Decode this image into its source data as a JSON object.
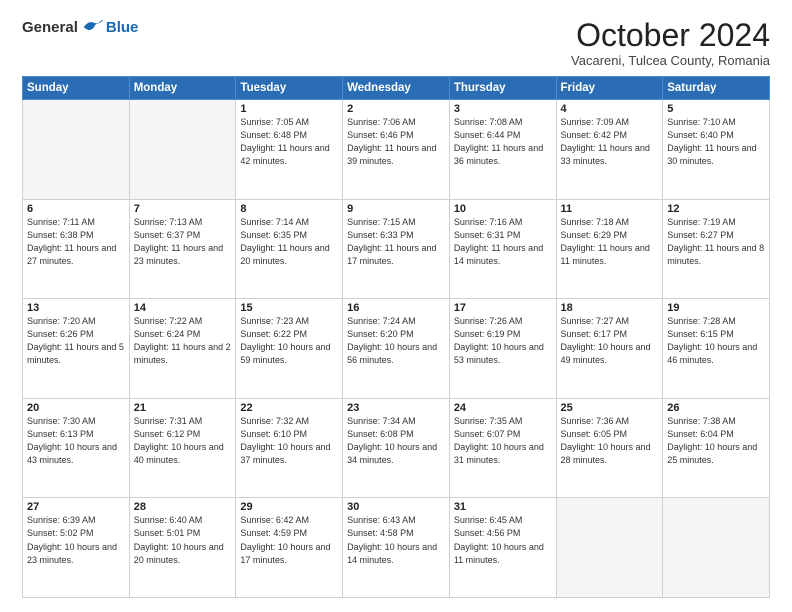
{
  "logo": {
    "general": "General",
    "blue": "Blue"
  },
  "header": {
    "month": "October 2024",
    "subtitle": "Vacareni, Tulcea County, Romania"
  },
  "weekdays": [
    "Sunday",
    "Monday",
    "Tuesday",
    "Wednesday",
    "Thursday",
    "Friday",
    "Saturday"
  ],
  "weeks": [
    [
      {
        "day": "",
        "info": ""
      },
      {
        "day": "",
        "info": ""
      },
      {
        "day": "1",
        "info": "Sunrise: 7:05 AM\nSunset: 6:48 PM\nDaylight: 11 hours and 42 minutes."
      },
      {
        "day": "2",
        "info": "Sunrise: 7:06 AM\nSunset: 6:46 PM\nDaylight: 11 hours and 39 minutes."
      },
      {
        "day": "3",
        "info": "Sunrise: 7:08 AM\nSunset: 6:44 PM\nDaylight: 11 hours and 36 minutes."
      },
      {
        "day": "4",
        "info": "Sunrise: 7:09 AM\nSunset: 6:42 PM\nDaylight: 11 hours and 33 minutes."
      },
      {
        "day": "5",
        "info": "Sunrise: 7:10 AM\nSunset: 6:40 PM\nDaylight: 11 hours and 30 minutes."
      }
    ],
    [
      {
        "day": "6",
        "info": "Sunrise: 7:11 AM\nSunset: 6:38 PM\nDaylight: 11 hours and 27 minutes."
      },
      {
        "day": "7",
        "info": "Sunrise: 7:13 AM\nSunset: 6:37 PM\nDaylight: 11 hours and 23 minutes."
      },
      {
        "day": "8",
        "info": "Sunrise: 7:14 AM\nSunset: 6:35 PM\nDaylight: 11 hours and 20 minutes."
      },
      {
        "day": "9",
        "info": "Sunrise: 7:15 AM\nSunset: 6:33 PM\nDaylight: 11 hours and 17 minutes."
      },
      {
        "day": "10",
        "info": "Sunrise: 7:16 AM\nSunset: 6:31 PM\nDaylight: 11 hours and 14 minutes."
      },
      {
        "day": "11",
        "info": "Sunrise: 7:18 AM\nSunset: 6:29 PM\nDaylight: 11 hours and 11 minutes."
      },
      {
        "day": "12",
        "info": "Sunrise: 7:19 AM\nSunset: 6:27 PM\nDaylight: 11 hours and 8 minutes."
      }
    ],
    [
      {
        "day": "13",
        "info": "Sunrise: 7:20 AM\nSunset: 6:26 PM\nDaylight: 11 hours and 5 minutes."
      },
      {
        "day": "14",
        "info": "Sunrise: 7:22 AM\nSunset: 6:24 PM\nDaylight: 11 hours and 2 minutes."
      },
      {
        "day": "15",
        "info": "Sunrise: 7:23 AM\nSunset: 6:22 PM\nDaylight: 10 hours and 59 minutes."
      },
      {
        "day": "16",
        "info": "Sunrise: 7:24 AM\nSunset: 6:20 PM\nDaylight: 10 hours and 56 minutes."
      },
      {
        "day": "17",
        "info": "Sunrise: 7:26 AM\nSunset: 6:19 PM\nDaylight: 10 hours and 53 minutes."
      },
      {
        "day": "18",
        "info": "Sunrise: 7:27 AM\nSunset: 6:17 PM\nDaylight: 10 hours and 49 minutes."
      },
      {
        "day": "19",
        "info": "Sunrise: 7:28 AM\nSunset: 6:15 PM\nDaylight: 10 hours and 46 minutes."
      }
    ],
    [
      {
        "day": "20",
        "info": "Sunrise: 7:30 AM\nSunset: 6:13 PM\nDaylight: 10 hours and 43 minutes."
      },
      {
        "day": "21",
        "info": "Sunrise: 7:31 AM\nSunset: 6:12 PM\nDaylight: 10 hours and 40 minutes."
      },
      {
        "day": "22",
        "info": "Sunrise: 7:32 AM\nSunset: 6:10 PM\nDaylight: 10 hours and 37 minutes."
      },
      {
        "day": "23",
        "info": "Sunrise: 7:34 AM\nSunset: 6:08 PM\nDaylight: 10 hours and 34 minutes."
      },
      {
        "day": "24",
        "info": "Sunrise: 7:35 AM\nSunset: 6:07 PM\nDaylight: 10 hours and 31 minutes."
      },
      {
        "day": "25",
        "info": "Sunrise: 7:36 AM\nSunset: 6:05 PM\nDaylight: 10 hours and 28 minutes."
      },
      {
        "day": "26",
        "info": "Sunrise: 7:38 AM\nSunset: 6:04 PM\nDaylight: 10 hours and 25 minutes."
      }
    ],
    [
      {
        "day": "27",
        "info": "Sunrise: 6:39 AM\nSunset: 5:02 PM\nDaylight: 10 hours and 23 minutes."
      },
      {
        "day": "28",
        "info": "Sunrise: 6:40 AM\nSunset: 5:01 PM\nDaylight: 10 hours and 20 minutes."
      },
      {
        "day": "29",
        "info": "Sunrise: 6:42 AM\nSunset: 4:59 PM\nDaylight: 10 hours and 17 minutes."
      },
      {
        "day": "30",
        "info": "Sunrise: 6:43 AM\nSunset: 4:58 PM\nDaylight: 10 hours and 14 minutes."
      },
      {
        "day": "31",
        "info": "Sunrise: 6:45 AM\nSunset: 4:56 PM\nDaylight: 10 hours and 11 minutes."
      },
      {
        "day": "",
        "info": ""
      },
      {
        "day": "",
        "info": ""
      }
    ]
  ]
}
